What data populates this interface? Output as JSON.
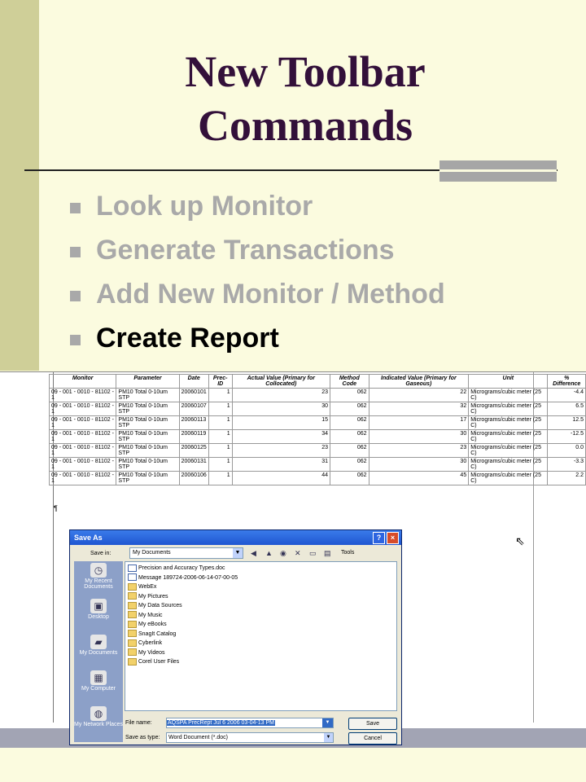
{
  "slide": {
    "title_line1": "New Toolbar",
    "title_line2": "Commands",
    "bullets": [
      "Look up Monitor",
      "Generate Transactions",
      "Add New Monitor / Method",
      "Create Report"
    ]
  },
  "table": {
    "headers": [
      "Monitor",
      "Parameter",
      "Date",
      "Prec-ID",
      "Actual Value (Primary for Collocated)",
      "Method Code",
      "Indicated Value (Primary for Gaseous)",
      "Unit",
      "% Difference"
    ],
    "rows": [
      [
        "09 - 001 - 0010 - 81102 - 1",
        "PM10 Total 0-10um STP",
        "20060101",
        "1",
        "23",
        "062",
        "22",
        "Micrograms/cubic meter (25 C)",
        "-4.4"
      ],
      [
        "09 - 001 - 0010 - 81102 - 1",
        "PM10 Total 0-10um STP",
        "20060107",
        "1",
        "30",
        "062",
        "32",
        "Micrograms/cubic meter (25 C)",
        "6.5"
      ],
      [
        "09 - 001 - 0010 - 81102 - 1",
        "PM10 Total 0-10um STP",
        "20060113",
        "1",
        "15",
        "062",
        "17",
        "Micrograms/cubic meter (25 C)",
        "12.5"
      ],
      [
        "09 - 001 - 0010 - 81102 - 1",
        "PM10 Total 0-10um STP",
        "20060119",
        "1",
        "34",
        "062",
        "30",
        "Micrograms/cubic meter (25 C)",
        "-12.5"
      ],
      [
        "09 - 001 - 0010 - 81102 - 1",
        "PM10 Total 0-10um STP",
        "20060125",
        "1",
        "23",
        "062",
        "23",
        "Micrograms/cubic meter (25 C)",
        "0.0"
      ],
      [
        "09 - 001 - 0010 - 81102 - 1",
        "PM10 Total 0-10um STP",
        "20060131",
        "1",
        "31",
        "062",
        "30",
        "Micrograms/cubic meter (25 C)",
        "-3.3"
      ],
      [
        "09 - 001 - 0010 - 81102 - 1",
        "PM10 Total 0-10um STP",
        "20060106",
        "1",
        "44",
        "062",
        "45",
        "Micrograms/cubic meter (25 C)",
        "2.2"
      ]
    ]
  },
  "dialog": {
    "title": "Save As",
    "help": "?",
    "close": "×",
    "save_in_label": "Save in:",
    "save_in_value": "My Documents",
    "tools_label": "Tools",
    "places": [
      "My Recent Documents",
      "Desktop",
      "My Documents",
      "My Computer",
      "My Network Places"
    ],
    "files": [
      "Precision and Accuracy Types.doc",
      "Message 189724-2006-06-14-07-00-05",
      "WebEx",
      "My Pictures",
      "My Data Sources",
      "My Music",
      "My eBooks",
      "SnagIt Catalog",
      "Cyberlink",
      "My Videos",
      "Corel User Files"
    ],
    "file_name_label": "File name:",
    "file_name_value": "AQSPA PrecRept Jul 6 2006 03-04-13 PM",
    "save_type_label": "Save as type:",
    "save_type_value": "Word Document (*.doc)",
    "save_button": "Save",
    "cancel_button": "Cancel"
  },
  "colors": {
    "title": "#33103a",
    "bullet_inactive": "#a9a9a9",
    "bullet_active": "#000000",
    "background": "#fbfbdf",
    "left_bar": "#cfcf98"
  }
}
